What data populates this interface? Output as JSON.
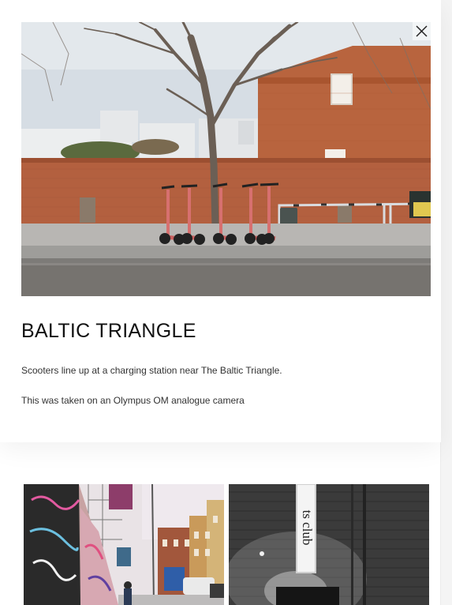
{
  "photo": {
    "title": "BALTIC TRIANGLE",
    "caption": "Scooters line up at a charging station near The Baltic Triangle.",
    "note": "This was taken on an Olympus OM analogue camera",
    "image_alt": "Five rental e-scooters parked at a charging station in front of a brick wall and bare tree",
    "close_icon": "close-icon"
  },
  "gallery": {
    "items": [
      {
        "alt": "Graffiti-covered wall on a city street with red-brick buildings",
        "sign_text": ""
      },
      {
        "alt": "Black and white photo of a brick building with an illuminated vertical club sign",
        "sign_text": "ts club"
      }
    ]
  },
  "colors": {
    "brick": "#b4603f",
    "scooter": "#d7706f",
    "sky": "#d6dde4"
  }
}
